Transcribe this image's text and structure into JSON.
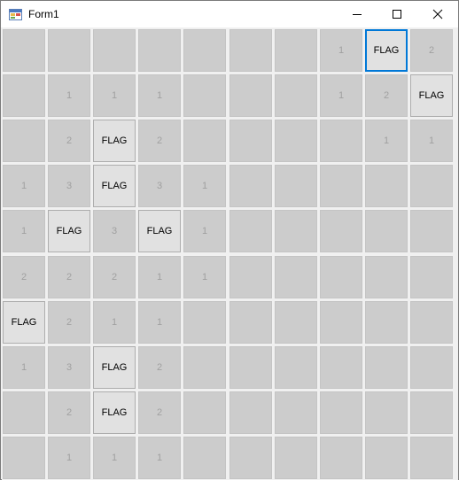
{
  "window": {
    "title": "Form1"
  },
  "icons": {
    "app": "app-form-icon",
    "minimize": "minimize-icon",
    "maximize": "maximize-icon",
    "close": "close-icon"
  },
  "colors": {
    "revealed_bg": "#cccccc",
    "flag_bg": "#e1e1e1",
    "focus_border": "#0078d7",
    "number_text": "#a0a0a0"
  },
  "board": {
    "rows": [
      [
        "",
        "",
        "",
        "",
        "",
        "",
        "",
        "1",
        "FLAG",
        "2"
      ],
      [
        "",
        "1",
        "1",
        "1",
        "",
        "",
        "",
        "1",
        "2",
        "FLAG"
      ],
      [
        "",
        "2",
        "FLAG",
        "2",
        "",
        "",
        "",
        "",
        "1",
        "1"
      ],
      [
        "1",
        "3",
        "FLAG",
        "3",
        "1",
        "",
        "",
        "",
        "",
        ""
      ],
      [
        "1",
        "FLAG",
        "3",
        "FLAG",
        "1",
        "",
        "",
        "",
        "",
        ""
      ],
      [
        "2",
        "2",
        "2",
        "1",
        "1",
        "",
        "",
        "",
        "",
        ""
      ],
      [
        "FLAG",
        "2",
        "1",
        "1",
        "",
        "",
        "",
        "",
        "",
        ""
      ],
      [
        "1",
        "3",
        "FLAG",
        "2",
        "",
        "",
        "",
        "",
        "",
        ""
      ],
      [
        "",
        "2",
        "FLAG",
        "2",
        "",
        "",
        "",
        "",
        "",
        ""
      ],
      [
        "",
        "1",
        "1",
        "1",
        "",
        "",
        "",
        "",
        "",
        ""
      ]
    ]
  }
}
